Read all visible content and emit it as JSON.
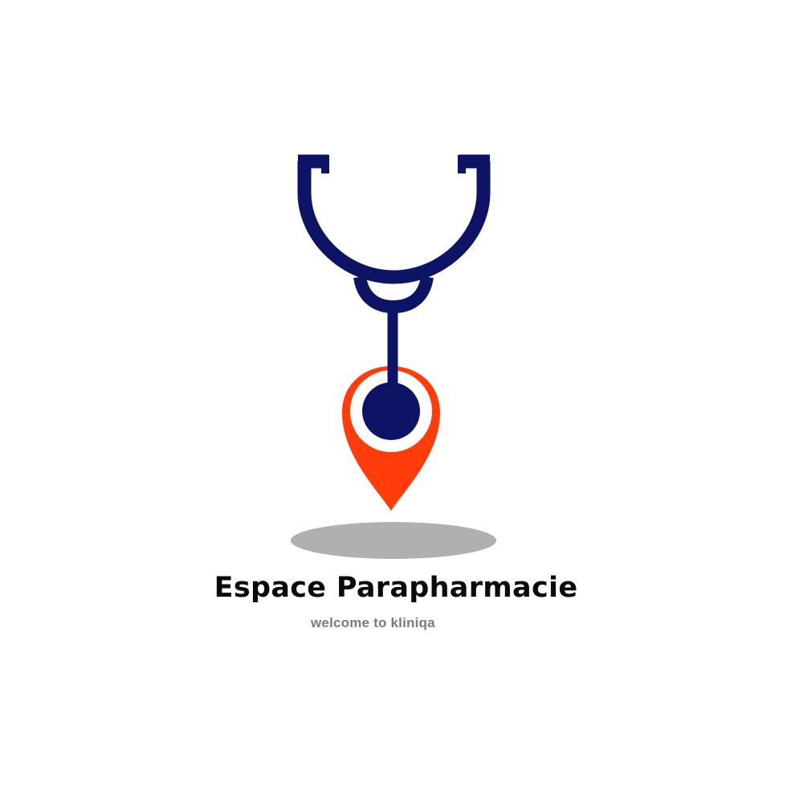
{
  "brand": {
    "title": "Espace Parapharmacie",
    "tagline": "welcome to kliniqa"
  },
  "logo": {
    "icon": "stethoscope-location-pin-icon",
    "colors": {
      "stethoscope": "#0d1466",
      "pin": "#ff3c0a",
      "shadow": "#b0b0b0",
      "background": "#ffffff"
    }
  }
}
